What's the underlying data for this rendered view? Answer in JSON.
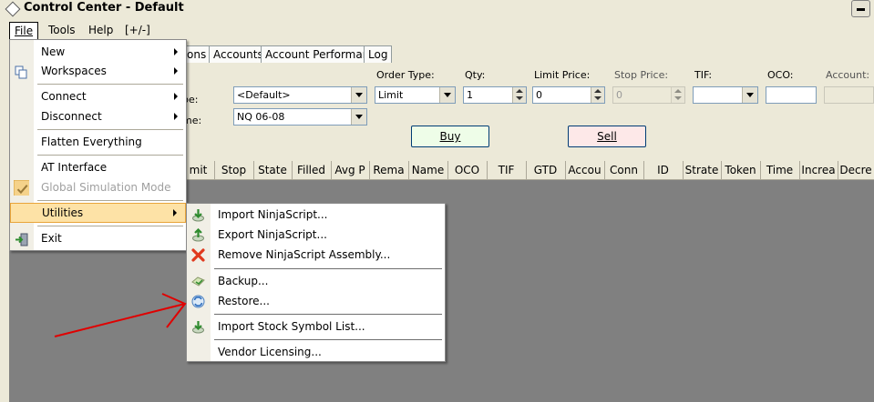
{
  "window": {
    "title": "Control Center - Default"
  },
  "menubar": {
    "file": "File",
    "tools": "Tools",
    "help": "Help",
    "plusminus": "[+/-]"
  },
  "tabs": [
    "ons",
    "Accounts",
    "Account Performance",
    "Log"
  ],
  "order_entry": {
    "type_label": "pe:",
    "type_value": "<Default>",
    "name_label": "me:",
    "instrument_value": "NQ 06-08",
    "order_type_label": "Order Type:",
    "order_type_value": "Limit",
    "qty_label": "Qty:",
    "qty_value": "1",
    "limit_price_label": "Limit Price:",
    "limit_price_value": "0",
    "stop_price_label": "Stop Price:",
    "stop_price_value": "0",
    "tif_label": "TIF:",
    "tif_value": "",
    "oco_label": "OCO:",
    "oco_value": "",
    "account_label": "Account:",
    "buy_label": "Buy",
    "sell_label": "Sell"
  },
  "grid_columns": [
    "mit",
    "Stop",
    "State",
    "Filled",
    "Avg P",
    "Rema",
    "Name",
    "OCO",
    "TIF",
    "GTD",
    "Accou",
    "Conn",
    "ID",
    "Strate",
    "Token",
    "Time",
    "Increa",
    "Decre"
  ],
  "file_menu": {
    "items": [
      {
        "label": "New",
        "submenu": true,
        "icon": ""
      },
      {
        "label": "Workspaces",
        "submenu": true,
        "icon": "copy-icon"
      },
      {
        "label": "Connect",
        "submenu": true,
        "icon": ""
      },
      {
        "label": "Disconnect",
        "submenu": true,
        "icon": ""
      },
      {
        "label": "Flatten Everything",
        "submenu": false,
        "icon": ""
      },
      {
        "label": "AT Interface",
        "submenu": false,
        "icon": ""
      },
      {
        "label": "Global Simulation Mode",
        "submenu": false,
        "disabled": true,
        "checked": true,
        "icon": "check-icon"
      },
      {
        "label": "Utilities",
        "submenu": true,
        "selected": true,
        "icon": ""
      },
      {
        "label": "Exit",
        "submenu": false,
        "icon": "exit-icon"
      }
    ]
  },
  "utilities_menu": {
    "items": [
      {
        "label": "Import NinjaScript...",
        "icon": "import-icon"
      },
      {
        "label": "Export NinjaScript...",
        "icon": "export-icon"
      },
      {
        "label": "Remove NinjaScript Assembly...",
        "icon": "remove-icon"
      },
      {
        "label": "Backup...",
        "icon": "backup-icon"
      },
      {
        "label": "Restore...",
        "icon": "restore-icon"
      },
      {
        "label": "Import Stock Symbol List...",
        "icon": "import-icon"
      },
      {
        "label": "Vendor Licensing...",
        "icon": ""
      }
    ]
  },
  "colors": {
    "highlight": "#fde2a6",
    "annotation_arrow": "#e00000",
    "grid_bg": "#808080"
  }
}
